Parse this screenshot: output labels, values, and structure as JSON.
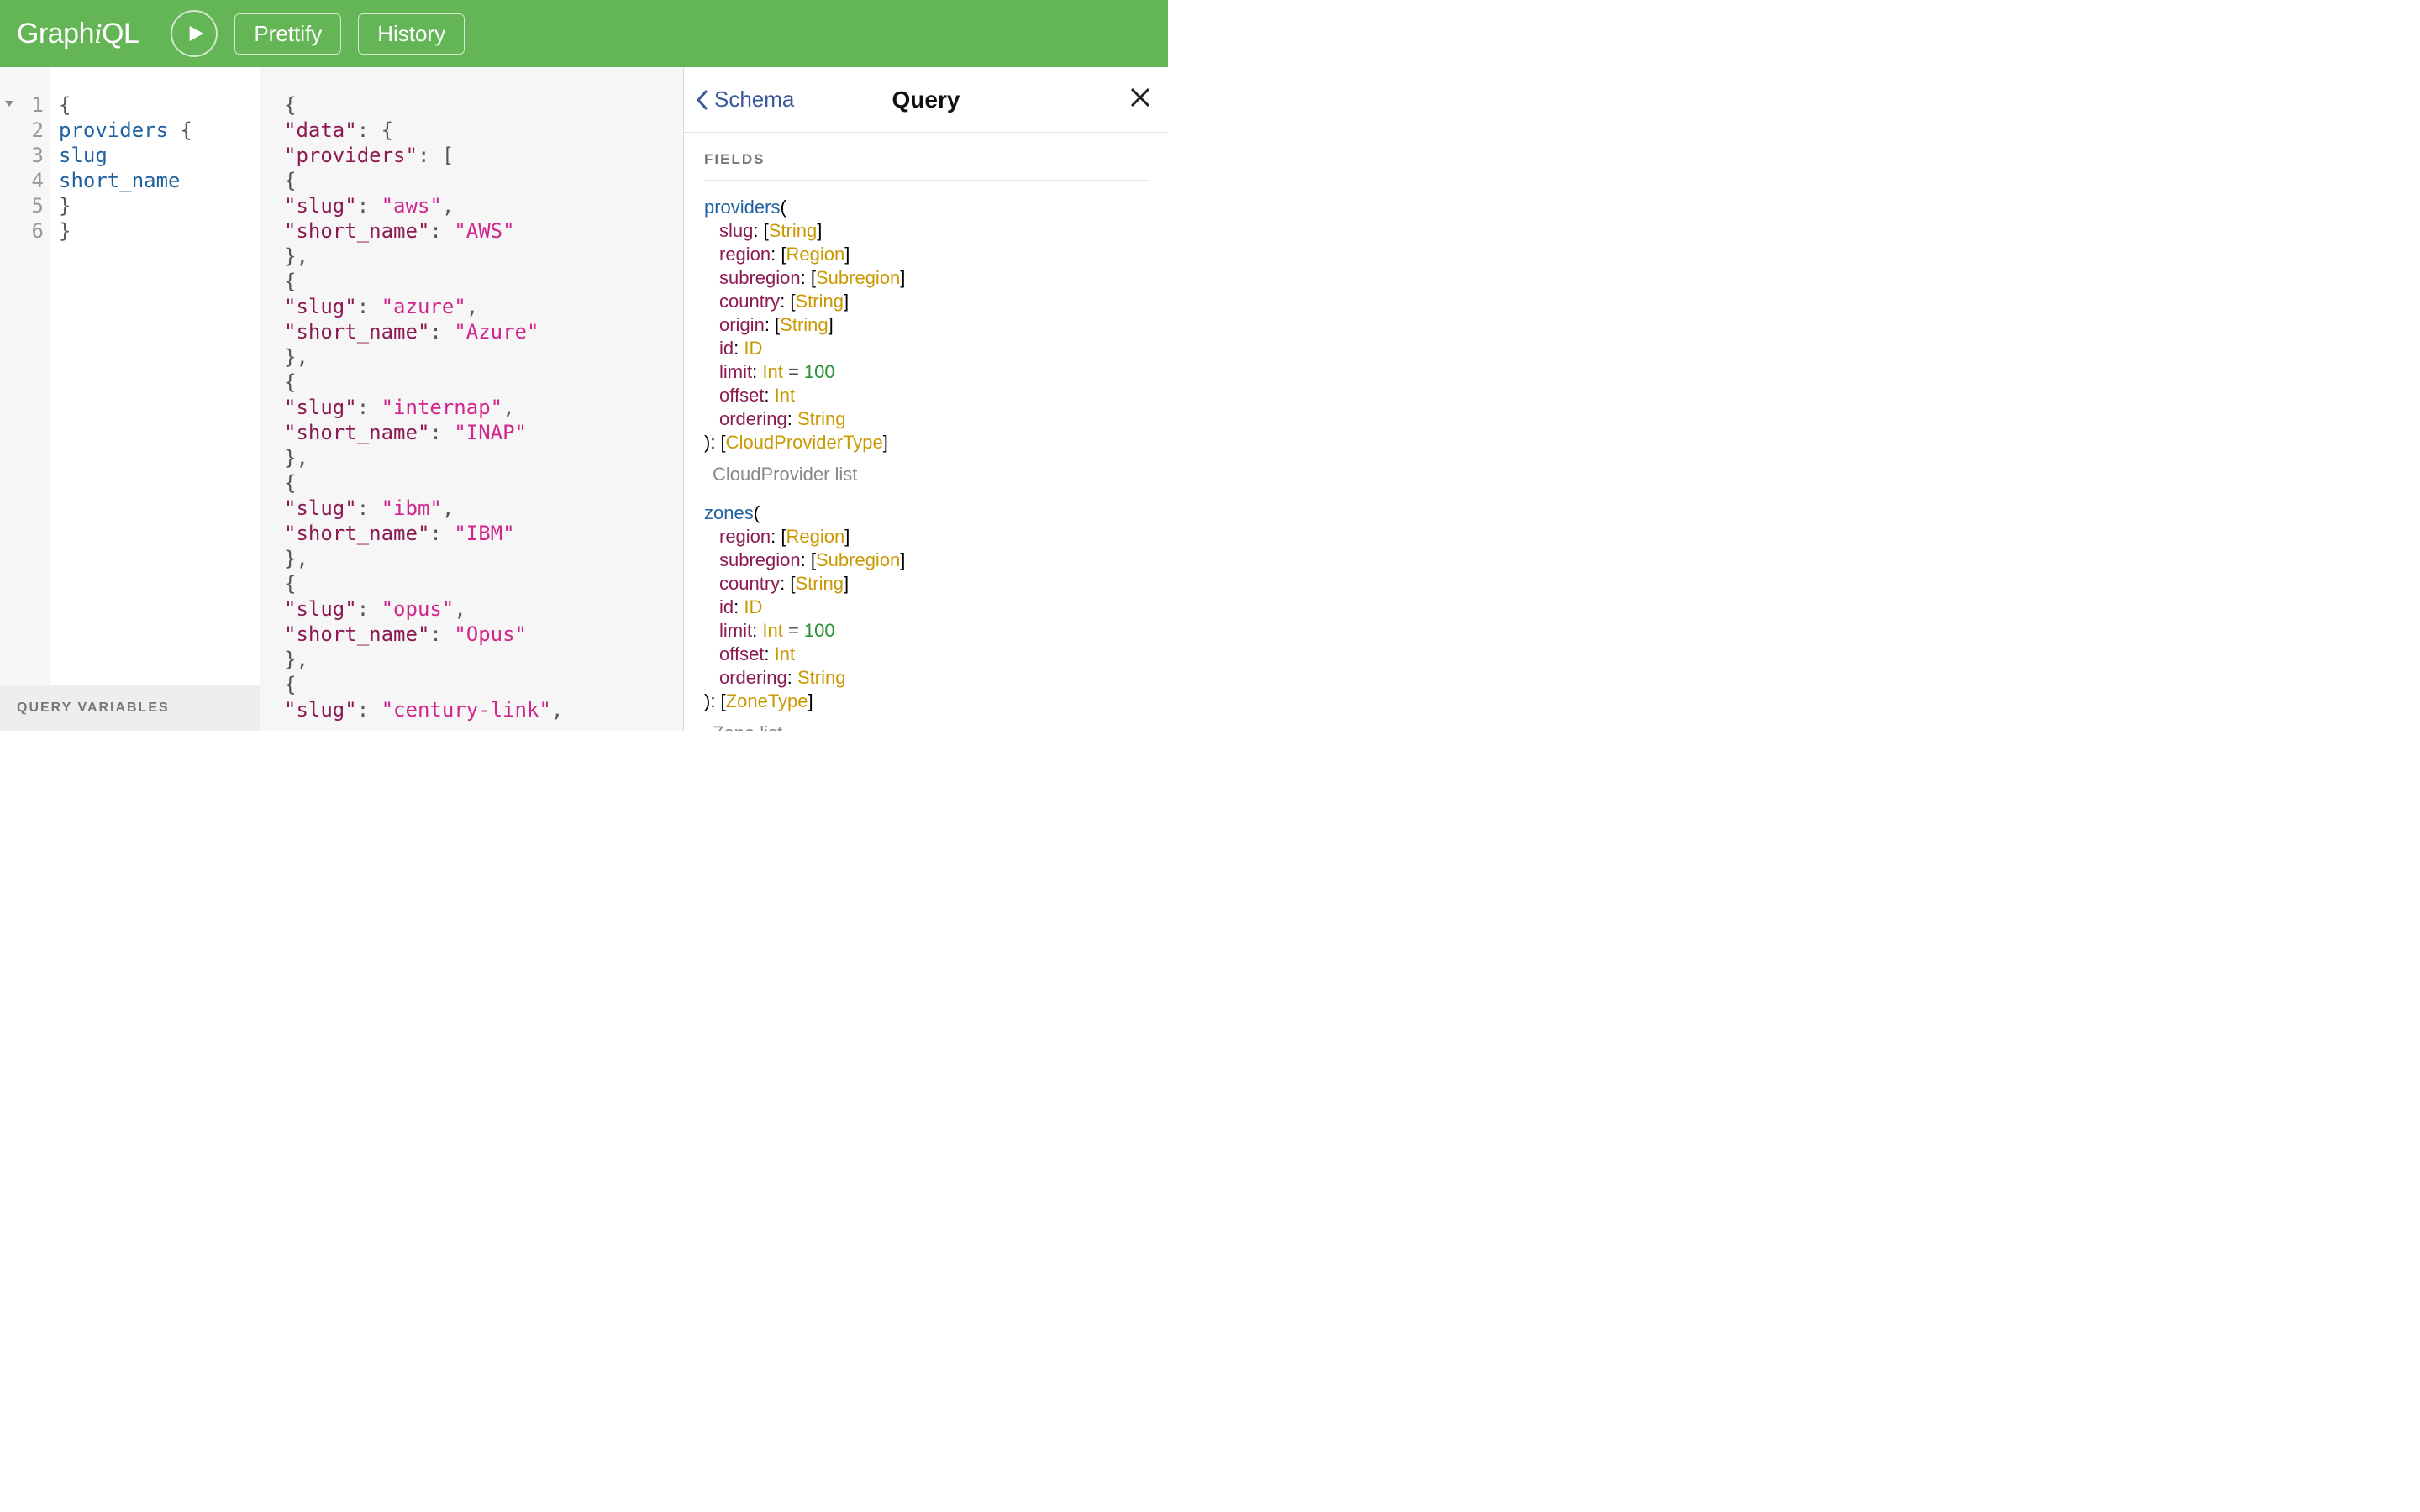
{
  "brand": "GraphiQL",
  "toolbar": {
    "prettify": "Prettify",
    "history": "History"
  },
  "query_editor": {
    "line_numbers": [
      "1",
      "2",
      "3",
      "4",
      "5",
      "6"
    ],
    "lines": [
      [
        {
          "t": "{",
          "c": "brace"
        }
      ],
      [
        {
          "t": "  ",
          "c": ""
        },
        {
          "t": "providers",
          "c": "field"
        },
        {
          "t": " {",
          "c": "brace"
        }
      ],
      [
        {
          "t": "    ",
          "c": ""
        },
        {
          "t": "slug",
          "c": "field"
        }
      ],
      [
        {
          "t": "    ",
          "c": ""
        },
        {
          "t": "short_name",
          "c": "field"
        }
      ],
      [
        {
          "t": "  }",
          "c": "brace"
        }
      ],
      [
        {
          "t": "}",
          "c": "brace"
        }
      ]
    ],
    "variables_label": "Query Variables"
  },
  "result": {
    "providers": [
      {
        "slug": "aws",
        "short_name": "AWS"
      },
      {
        "slug": "azure",
        "short_name": "Azure"
      },
      {
        "slug": "internap",
        "short_name": "INAP"
      },
      {
        "slug": "ibm",
        "short_name": "IBM"
      },
      {
        "slug": "opus",
        "short_name": "Opus"
      },
      {
        "slug": "century-link",
        "short_name": ""
      }
    ]
  },
  "docs": {
    "back_label": "Schema",
    "title": "Query",
    "fields_label": "Fields",
    "fields": [
      {
        "name": "providers",
        "args": [
          {
            "name": "slug",
            "type": "[String]"
          },
          {
            "name": "region",
            "type": "[Region]"
          },
          {
            "name": "subregion",
            "type": "[Subregion]"
          },
          {
            "name": "country",
            "type": "[String]"
          },
          {
            "name": "origin",
            "type": "[String]"
          },
          {
            "name": "id",
            "type": "ID"
          },
          {
            "name": "limit",
            "type": "Int",
            "default": "100"
          },
          {
            "name": "offset",
            "type": "Int"
          },
          {
            "name": "ordering",
            "type": "String"
          }
        ],
        "return_type": "[CloudProviderType]",
        "description": "CloudProvider list"
      },
      {
        "name": "zones",
        "args": [
          {
            "name": "region",
            "type": "[Region]"
          },
          {
            "name": "subregion",
            "type": "[Subregion]"
          },
          {
            "name": "country",
            "type": "[String]"
          },
          {
            "name": "id",
            "type": "ID"
          },
          {
            "name": "limit",
            "type": "Int",
            "default": "100"
          },
          {
            "name": "offset",
            "type": "Int"
          },
          {
            "name": "ordering",
            "type": "String"
          }
        ],
        "return_type": "[ZoneType]",
        "description": "Zone list"
      }
    ]
  }
}
